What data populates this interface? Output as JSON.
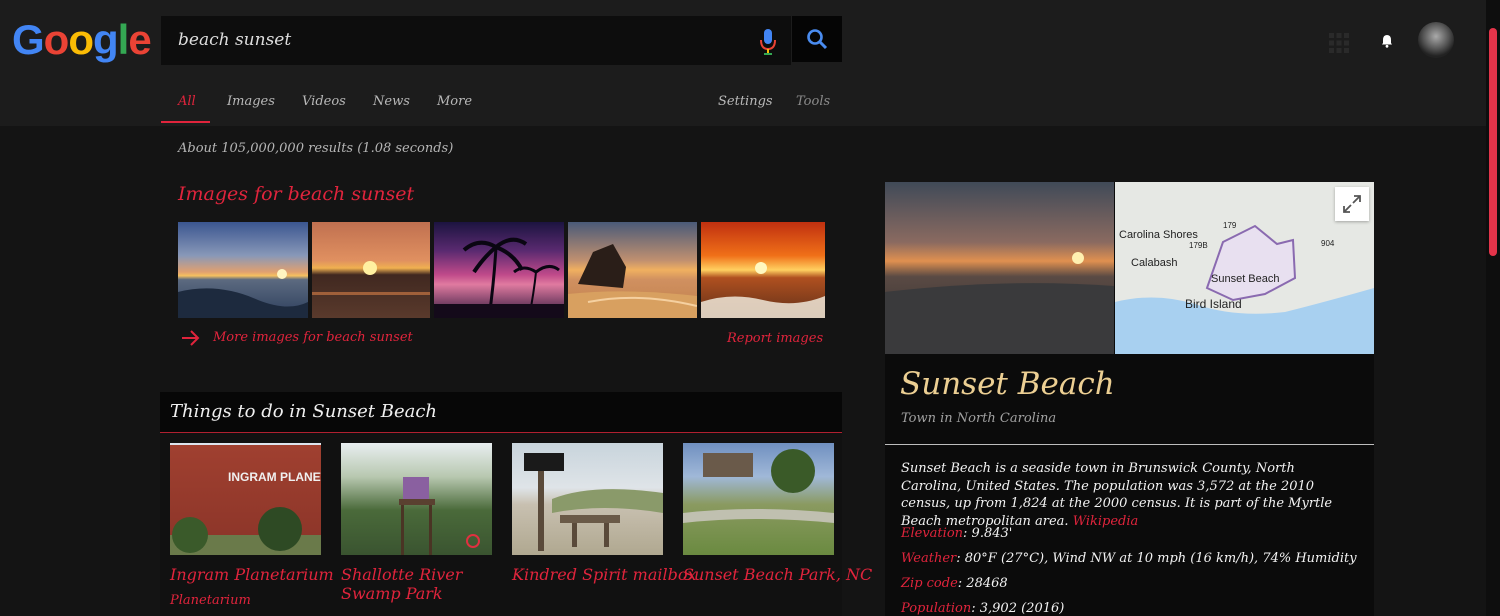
{
  "logo": {
    "letters": [
      "G",
      "o",
      "o",
      "g",
      "l",
      "e"
    ],
    "colors": [
      "#4285f4",
      "#ea4335",
      "#fbbc05",
      "#4285f4",
      "#34a853",
      "#ea4335"
    ]
  },
  "search": {
    "query": "beach sunset"
  },
  "tabs": {
    "all": "All",
    "images": "Images",
    "videos": "Videos",
    "news": "News",
    "more": "More",
    "settings": "Settings",
    "tools": "Tools"
  },
  "results": {
    "count": "About 105,000,000 results (1.08 seconds)"
  },
  "images_section": {
    "title": "Images for beach sunset",
    "more_link": "More images for beach sunset",
    "report_link": "Report images"
  },
  "things": {
    "title": "Things to do in Sunset Beach",
    "items": [
      {
        "name": "Ingram Planetarium",
        "category": "Planetarium",
        "sign_text": "INGRAM PLANETARIUM"
      },
      {
        "name": "Shallotte River Swamp Park"
      },
      {
        "name": "Kindred Spirit mailbox"
      },
      {
        "name": "Sunset Beach Park, NC"
      }
    ]
  },
  "knowledge_panel": {
    "title": "Sunset Beach",
    "subtitle": "Town in North Carolina",
    "map_labels": {
      "carolina_shores": "Carolina Shores",
      "calabash": "Calabash",
      "sunset_beach": "Sunset Beach",
      "bird_island": "Bird Island",
      "route_179": "179",
      "route_179b": "179B",
      "route_904": "904"
    },
    "description": "Sunset Beach is a seaside town in Brunswick County, North Carolina, United States. The population was 3,572 at the 2010 census, up from 1,824 at the 2000 census. It is part of the Myrtle Beach metropolitan area.",
    "source_link": "Wikipedia",
    "facts": [
      {
        "key": "Elevation",
        "value": ": 9.843'"
      },
      {
        "key": "Weather",
        "value": ": 80°F (27°C), Wind NW at 10 mph (16 km/h), 74% Humidity"
      },
      {
        "key": "Zip code",
        "value": ": 28468"
      },
      {
        "key": "Population",
        "value": ": 3,902 (2016)"
      }
    ]
  },
  "colors": {
    "accent": "#e0243c",
    "title_gold": "#eccf93",
    "background": "#141414"
  }
}
